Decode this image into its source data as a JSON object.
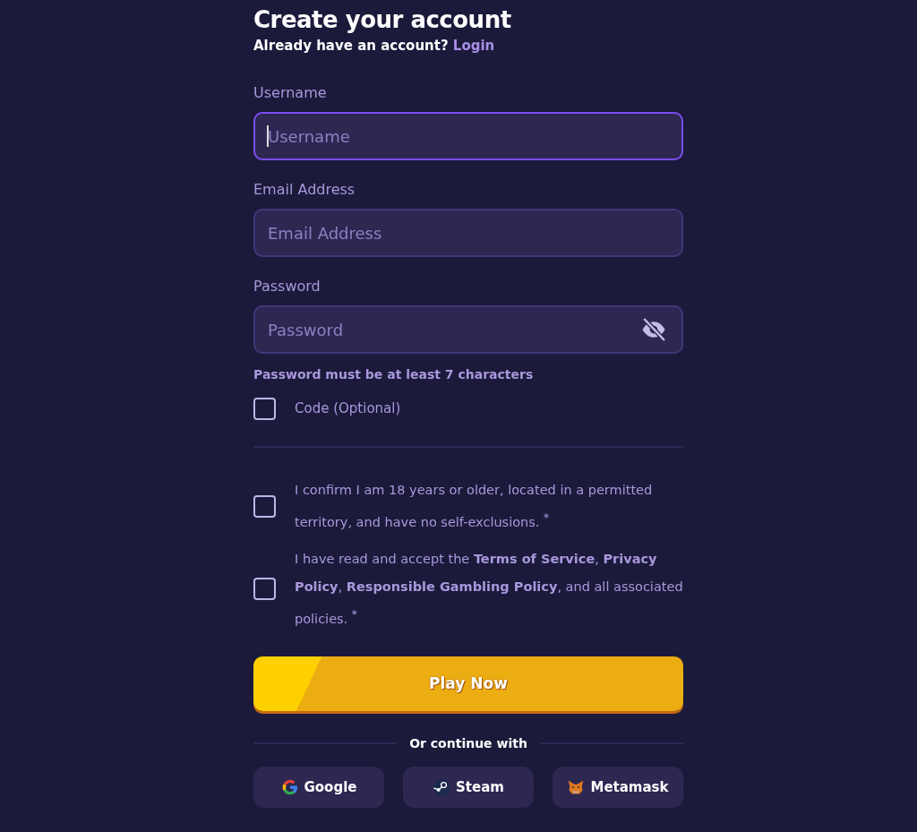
{
  "heading": {
    "title": "Create your account",
    "prompt": "Already have an account?",
    "link": "Login"
  },
  "fields": [
    {
      "label": "Username",
      "placeholder": "Username",
      "focused": true,
      "kind": "text"
    },
    {
      "label": "Email Address",
      "placeholder": "Email Address",
      "focused": false,
      "kind": "text"
    },
    {
      "label": "Password",
      "placeholder": "Password",
      "focused": false,
      "kind": "password"
    }
  ],
  "password_hint": "Password must be at least 7 characters",
  "code_option": {
    "label": "Code (Optional)",
    "checked": false
  },
  "agreements": [
    {
      "text": "I confirm I am 18 years or older, located in a permitted territory, and have no self-exclusions. $^{*}$",
      "checked": false
    },
    {
      "text": "I have read and accept the **Terms of Service**, **Privacy Policy**, **Responsible Gambling Policy**, and all associated policies. $^{*}$",
      "checked": false
    }
  ],
  "submit": "Play Now",
  "alt_label": "Or continue with",
  "providers": [
    {
      "label": "Google",
      "kind": "google"
    },
    {
      "label": "Steam",
      "kind": "steam"
    },
    {
      "label": "Metamask",
      "kind": "metamask"
    }
  ]
}
